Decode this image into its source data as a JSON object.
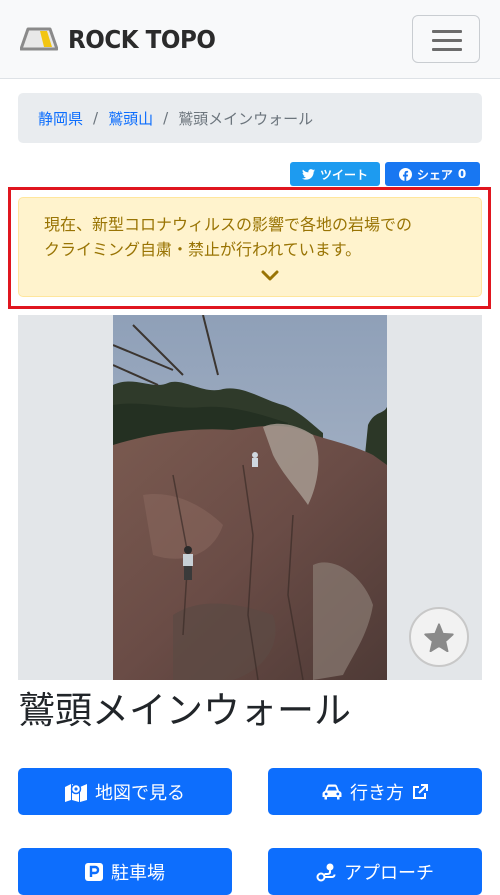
{
  "header": {
    "brand": "ROCK TOPO",
    "logo_icon": "mountain-logo-icon",
    "menu_icon": "hamburger-menu-icon"
  },
  "breadcrumb": {
    "items": [
      "静岡県",
      "鷲頭山"
    ],
    "current": "鷲頭メインウォール",
    "separator": "/"
  },
  "share": {
    "tweet_label": "ツイート",
    "facebook_label": "シェア",
    "facebook_count": "0"
  },
  "alert": {
    "line1": "現在、新型コロナウィルスの影響で各地の岩場での",
    "line2": "クライミング自粛・禁止が行われています。",
    "expand_icon": "chevron-down-icon"
  },
  "page": {
    "title": "鷲頭メインウォール",
    "favorite_icon": "star-icon"
  },
  "actions": {
    "map_label": "地図で見る",
    "directions_label": "行き方",
    "parking_label": "駐車場",
    "approach_label": "アプローチ"
  },
  "colors": {
    "primary": "#0d6efd",
    "alert_bg": "#fff3cd",
    "alert_text": "#997404",
    "highlight_border": "#e0161f",
    "twitter": "#1d9bf0",
    "facebook": "#1877f2"
  }
}
